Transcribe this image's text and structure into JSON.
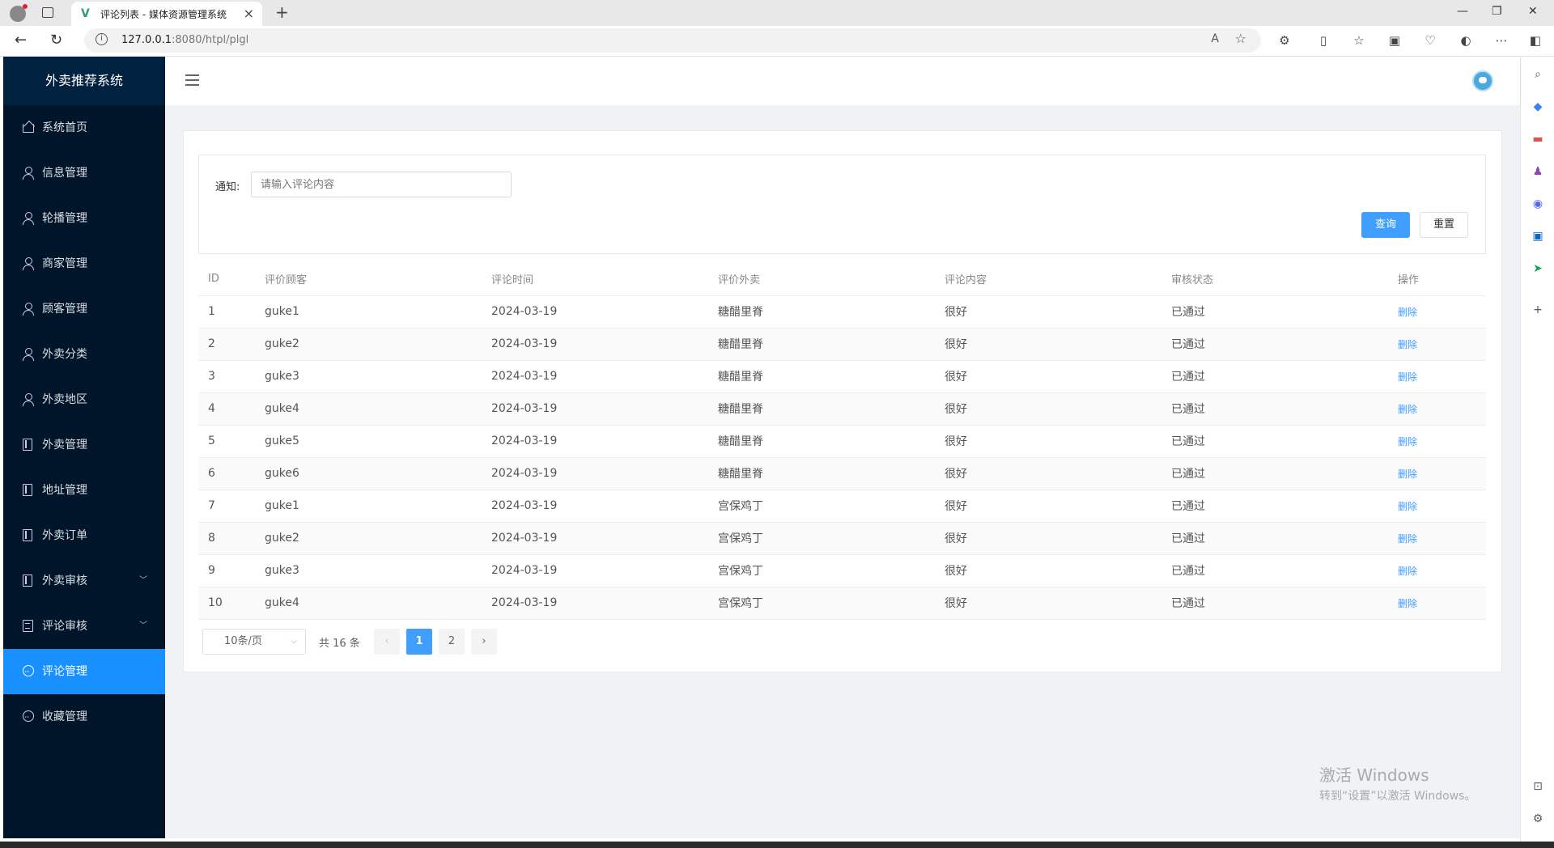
{
  "browser": {
    "tab_title": "评论列表 - 媒体资源管理系统",
    "url_host": "127.0.0.1",
    "url_rest": ":8080/htpl/plgl"
  },
  "app": {
    "brand": "外卖推荐系统",
    "menu": [
      {
        "label": "系统首页",
        "icon": "home-icon"
      },
      {
        "label": "信息管理",
        "icon": "user-icon"
      },
      {
        "label": "轮播管理",
        "icon": "user-icon"
      },
      {
        "label": "商家管理",
        "icon": "user-icon"
      },
      {
        "label": "顾客管理",
        "icon": "user-icon"
      },
      {
        "label": "外卖分类",
        "icon": "user-icon"
      },
      {
        "label": "外卖地区",
        "icon": "user-icon"
      },
      {
        "label": "外卖管理",
        "icon": "document-icon"
      },
      {
        "label": "地址管理",
        "icon": "document-icon"
      },
      {
        "label": "外卖订单",
        "icon": "document-icon"
      },
      {
        "label": "外卖审核",
        "icon": "document-icon",
        "expandable": true
      },
      {
        "label": "评论审核",
        "icon": "list-icon",
        "expandable": true
      },
      {
        "label": "评论管理",
        "icon": "chat-icon",
        "active": true
      },
      {
        "label": "收藏管理",
        "icon": "chat-icon"
      }
    ]
  },
  "filter": {
    "label": "通知:",
    "placeholder": "请输入评论内容",
    "search_button": "查询",
    "reset_button": "重置"
  },
  "table": {
    "headers": [
      "ID",
      "评价顾客",
      "评论时间",
      "评价外卖",
      "评论内容",
      "审核状态",
      "操作"
    ],
    "rows": [
      [
        "1",
        "guke1",
        "2024-03-19",
        "糖醋里脊",
        "很好",
        "已通过",
        "删除"
      ],
      [
        "2",
        "guke2",
        "2024-03-19",
        "糖醋里脊",
        "很好",
        "已通过",
        "删除"
      ],
      [
        "3",
        "guke3",
        "2024-03-19",
        "糖醋里脊",
        "很好",
        "已通过",
        "删除"
      ],
      [
        "4",
        "guke4",
        "2024-03-19",
        "糖醋里脊",
        "很好",
        "已通过",
        "删除"
      ],
      [
        "5",
        "guke5",
        "2024-03-19",
        "糖醋里脊",
        "很好",
        "已通过",
        "删除"
      ],
      [
        "6",
        "guke6",
        "2024-03-19",
        "糖醋里脊",
        "很好",
        "已通过",
        "删除"
      ],
      [
        "7",
        "guke1",
        "2024-03-19",
        "宫保鸡丁",
        "很好",
        "已通过",
        "删除"
      ],
      [
        "8",
        "guke2",
        "2024-03-19",
        "宫保鸡丁",
        "很好",
        "已通过",
        "删除"
      ],
      [
        "9",
        "guke3",
        "2024-03-19",
        "宫保鸡丁",
        "很好",
        "已通过",
        "删除"
      ],
      [
        "10",
        "guke4",
        "2024-03-19",
        "宫保鸡丁",
        "很好",
        "已通过",
        "删除"
      ]
    ]
  },
  "pagination": {
    "page_size": "10条/页",
    "total": "共 16 条",
    "pages": [
      "1",
      "2"
    ],
    "current": "1"
  },
  "watermark": {
    "line1": "激活 Windows",
    "line2": "转到“设置”以激活 Windows。"
  },
  "colors": {
    "sidebar_bg": "#001529",
    "active_menu": "#1890ff",
    "primary": "#409eff"
  }
}
